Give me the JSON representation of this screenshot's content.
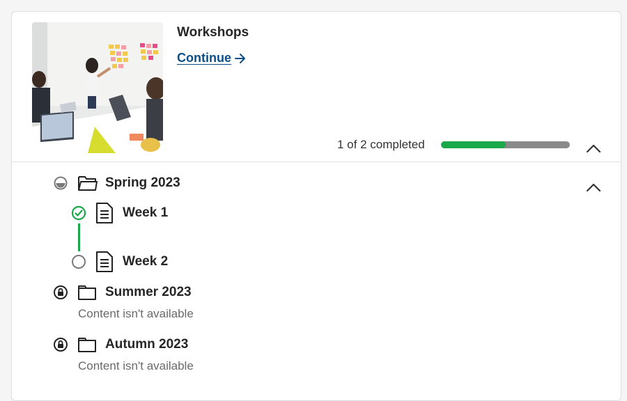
{
  "course": {
    "title": "Workshops",
    "continue_label": "Continue",
    "progress_text": "1 of 2 completed",
    "progress_fraction": 0.5,
    "colors": {
      "progress": "#1aa84a",
      "track": "#8a8a8a",
      "link": "#0b4f8a"
    }
  },
  "folders": [
    {
      "title": "Spring 2023",
      "status": "in-progress",
      "items": [
        {
          "title": "Week 1",
          "status": "completed"
        },
        {
          "title": "Week 2",
          "status": "not-started"
        }
      ]
    },
    {
      "title": "Summer 2023",
      "status": "locked",
      "message": "Content isn't available"
    },
    {
      "title": "Autumn 2023",
      "status": "locked",
      "message": "Content isn't available"
    }
  ]
}
